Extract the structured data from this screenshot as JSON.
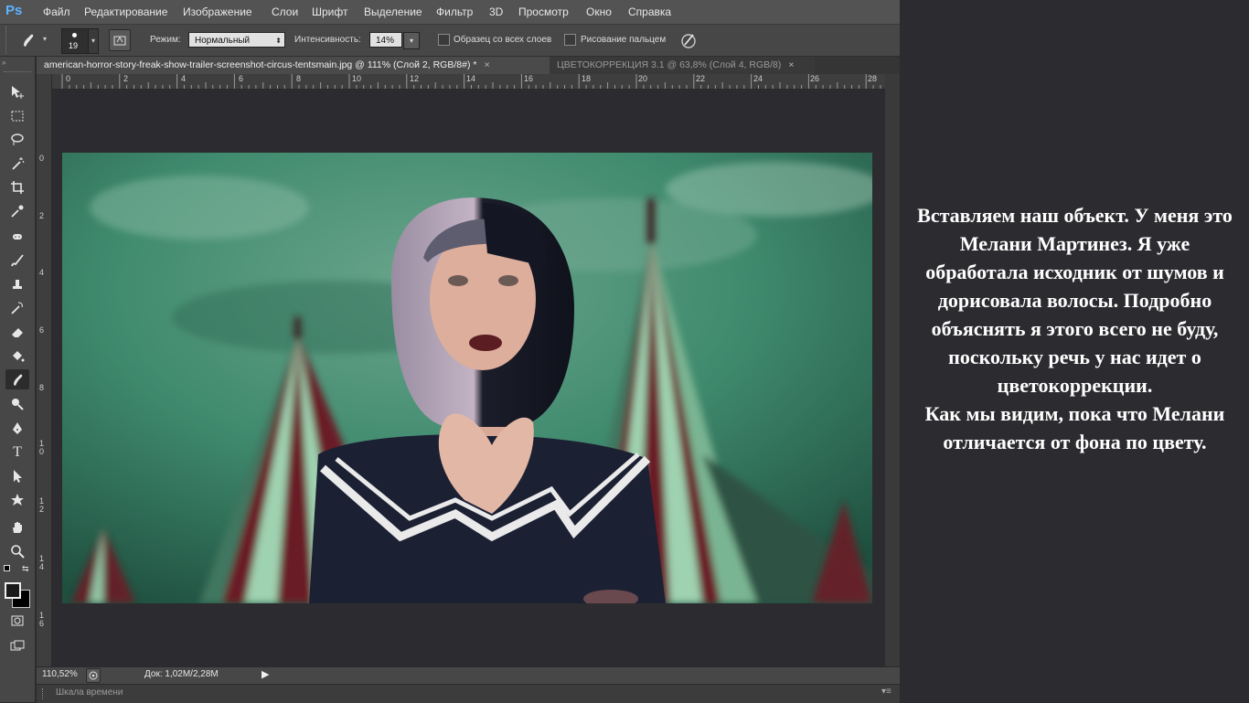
{
  "app": {
    "logo": "Ps",
    "menu": [
      "Файл",
      "Редактирование",
      "Изображение",
      "Слои",
      "Шрифт",
      "Выделение",
      "Фильтр",
      "3D",
      "Просмотр",
      "Окно",
      "Справка"
    ]
  },
  "options": {
    "brush_size": "19",
    "mode_label": "Режим:",
    "mode_value": "Нормальный",
    "intensity_label": "Интенсивность:",
    "intensity_value": "14%",
    "sample_all_layers": "Образец со всех слоев",
    "finger_painting": "Рисование пальцем"
  },
  "tabs": [
    {
      "label": "american-horror-story-freak-show-trailer-screenshot-circus-tentsmain.jpg @ 111% (Слой 2, RGB/8#) *",
      "close": "×",
      "active": true
    },
    {
      "label": "ЦВЕТОКОРРЕКЦИЯ 3.1 @ 63,8% (Слой 4, RGB/8)",
      "close": "×",
      "active": false
    }
  ],
  "ruler": {
    "top": [
      "0",
      "2",
      "4",
      "6",
      "8",
      "10",
      "12",
      "14",
      "16",
      "18",
      "20",
      "22",
      "24",
      "26",
      "28"
    ],
    "left": [
      "0",
      "2",
      "4",
      "6",
      "8",
      "1\n0",
      "1\n2",
      "1\n4",
      "1\n6"
    ]
  },
  "status": {
    "zoom": "110,52%",
    "doc": "Док: 1,02M/2,28M",
    "timeline": "Шкала времени"
  },
  "caption": "Вставляем наш объект.  У меня это Мелани Мартинез. Я уже обработала исходник от шумов и дорисовала волосы. Подробно объяснять я этого всего не буду, поскольку речь у нас идет о цветокоррекции.\nКак мы видим, пока что Мелани отличается от фона по цвету.",
  "colors": {
    "menubar": "#535353",
    "panel": "#474747",
    "canvas_bg": "#2c2b2f",
    "sky": "#3f8a6e",
    "tent_red": "#6b1f25",
    "tent_green": "#8fc9a6"
  }
}
